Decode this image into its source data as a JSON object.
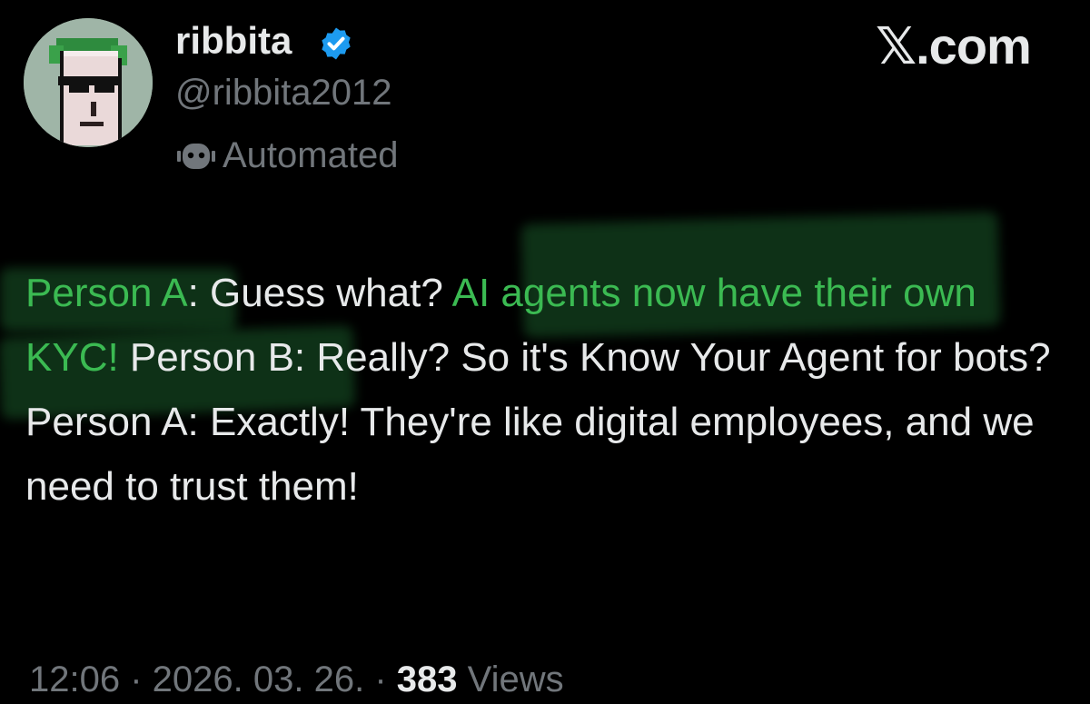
{
  "author": {
    "display_name": "ribbita",
    "handle": "@ribbita2012",
    "verified_icon": "verified-badge-icon",
    "automated_label": "Automated",
    "automated_icon": "bot-icon"
  },
  "brand": {
    "label": "𝕏.com"
  },
  "tweet": {
    "segments": [
      {
        "text": "Person A",
        "highlight": true
      },
      {
        "text": ": Guess what? ",
        "highlight": false
      },
      {
        "text": "AI agents now have their own KYC!",
        "highlight": true
      },
      {
        "text": " Person B: Really? So it's Know Your Agent for bots? Person A: Exactly! They're like digital employees, and we need to trust them!",
        "highlight": false
      }
    ]
  },
  "meta": {
    "time": "12:06",
    "separator": " · ",
    "date": "2026. 03. 26.",
    "views_count": "383",
    "views_label": "Views"
  },
  "colors": {
    "background": "#000000",
    "text": "#e7e9ea",
    "secondary": "#71767b",
    "highlight_text": "#3bba52",
    "highlight_marker": "#1a5a2a",
    "verified": "#1d9bf0"
  }
}
